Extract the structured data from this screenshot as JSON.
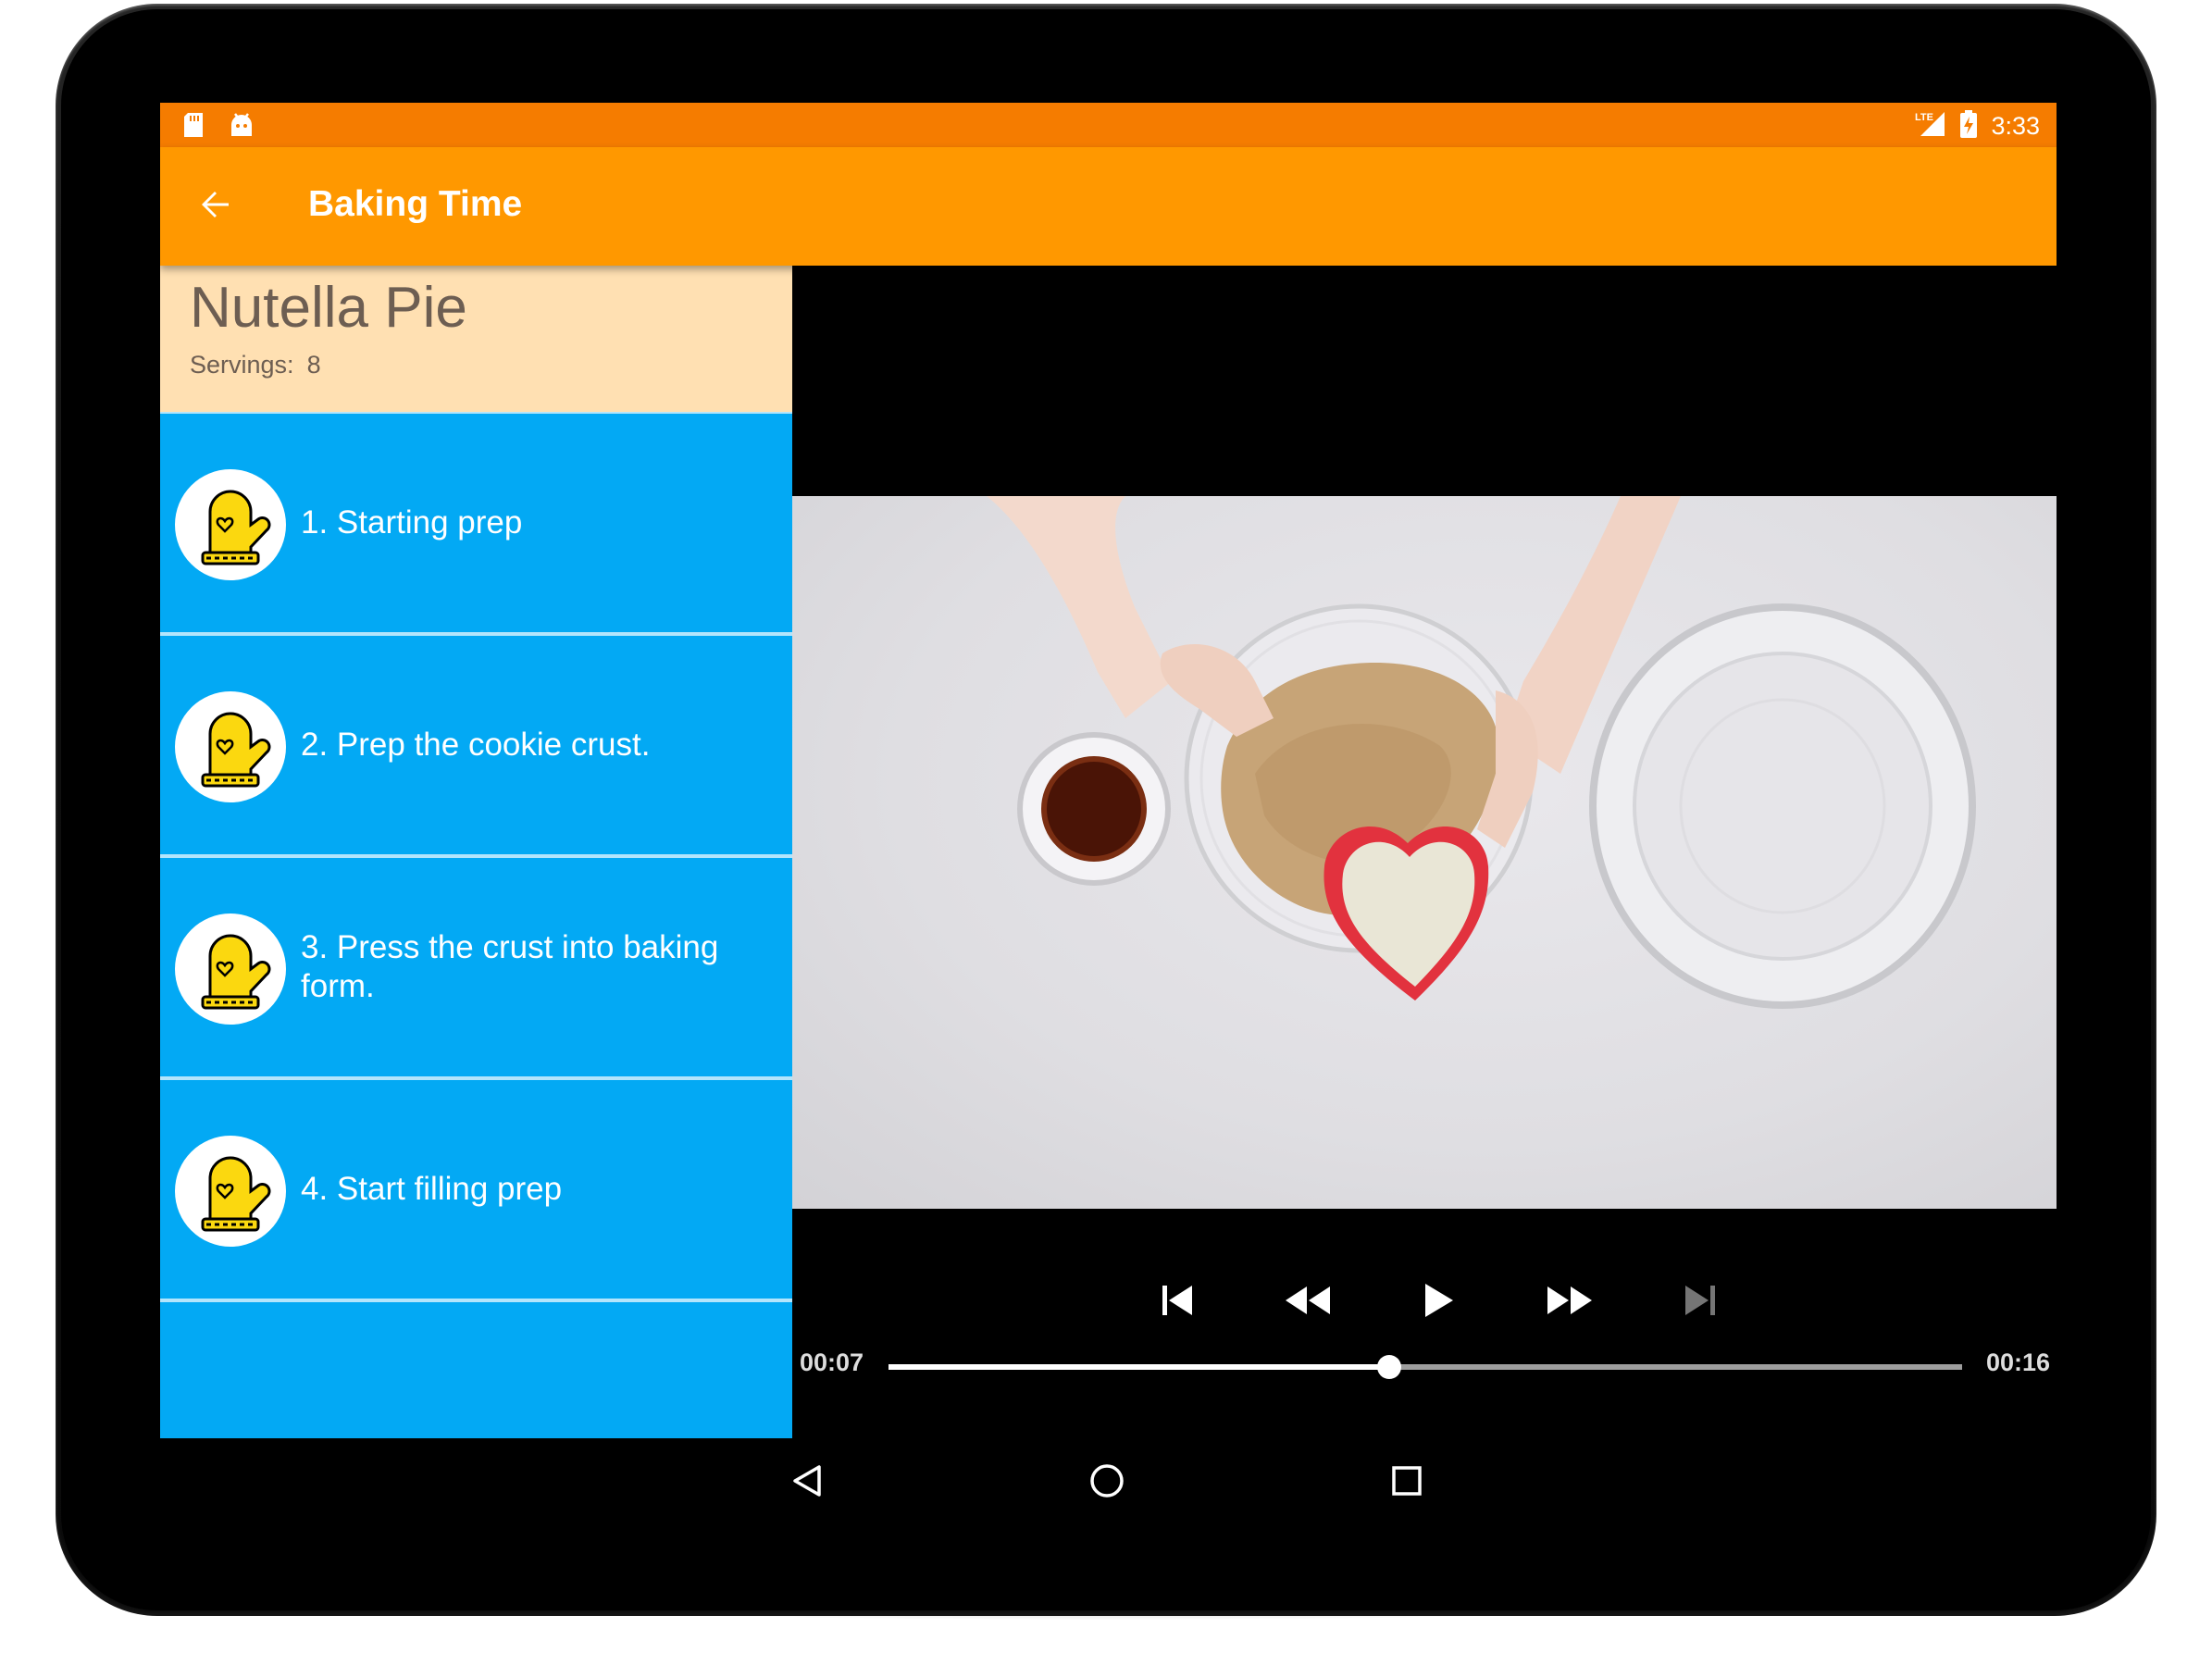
{
  "status_bar": {
    "time": "3:33",
    "left_icons": [
      "sd-card-icon",
      "android-icon"
    ],
    "right_icons": [
      "lte-signal-icon",
      "battery-charging-icon"
    ]
  },
  "app_bar": {
    "title": "Baking Time",
    "back_icon": "arrow-back-icon"
  },
  "recipe": {
    "name": "Nutella Pie",
    "servings_label": "Servings:",
    "servings_value": "8"
  },
  "steps": [
    {
      "label": "1. Starting prep"
    },
    {
      "label": "2. Prep the cookie crust."
    },
    {
      "label": "3. Press the crust into baking form."
    },
    {
      "label": "4. Start filling prep"
    }
  ],
  "player": {
    "position": "00:07",
    "duration": "00:16",
    "progress": 0.4667,
    "controls": [
      "skip-previous-icon",
      "rewind-icon",
      "play-icon",
      "fast-forward-icon",
      "skip-next-icon"
    ]
  },
  "nav_bar": {
    "buttons": [
      "back-triangle-icon",
      "home-circle-icon",
      "recents-square-icon"
    ]
  },
  "colors": {
    "status_bar": "#f57c00",
    "app_bar": "#ff9800",
    "recipe_header": "#ffe0b2",
    "step_list": "#03a9f4",
    "step_divider": "#b3e5fc"
  }
}
